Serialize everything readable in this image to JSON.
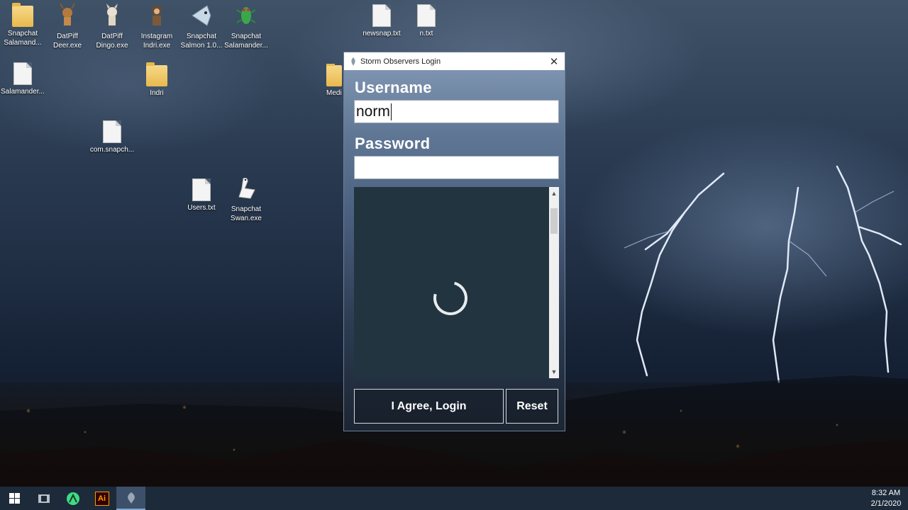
{
  "desktop": {
    "icons": [
      {
        "label": "Snapchat\nSalamand...",
        "icon": "folder-icon"
      },
      {
        "label": "DatPiff\nDeer.exe",
        "icon": "deer-icon"
      },
      {
        "label": "DatPiff\nDingo.exe",
        "icon": "dingo-icon"
      },
      {
        "label": "Instagram\nIndri.exe",
        "icon": "indri-icon"
      },
      {
        "label": "Snapchat\nSalmon 1.0...",
        "icon": "salmon-icon"
      },
      {
        "label": "Snapchat\nSalamander...",
        "icon": "salamander-icon"
      },
      {
        "label": "newsnap.txt",
        "icon": "text-file-icon"
      },
      {
        "label": "n.txt",
        "icon": "text-file-icon"
      },
      {
        "label": "Salamander...",
        "icon": "text-file-icon"
      },
      {
        "label": "Indri",
        "icon": "folder-icon"
      },
      {
        "label": "Medi",
        "icon": "folder-icon"
      },
      {
        "label": "com.snapch...",
        "icon": "text-file-icon"
      },
      {
        "label": "Users.txt",
        "icon": "text-file-icon"
      },
      {
        "label": "Snapchat\nSwan.exe",
        "icon": "swan-icon"
      }
    ]
  },
  "login_window": {
    "title": "Storm Observers Login",
    "close_glyph": "✕",
    "username_label": "Username",
    "username_value": "norm",
    "password_label": "Password",
    "password_value": "",
    "agree_login_label": "I Agree, Login",
    "reset_label": "Reset",
    "panel_state": "loading"
  },
  "taskbar": {
    "items": [
      "start-icon",
      "task-view-icon",
      "android-studio-icon",
      "illustrator-icon",
      "storm-app-icon"
    ],
    "active_item": "storm-app-icon",
    "illustrator_label": "Ai",
    "time": "8:32 AM",
    "date": "2/1/2020"
  }
}
